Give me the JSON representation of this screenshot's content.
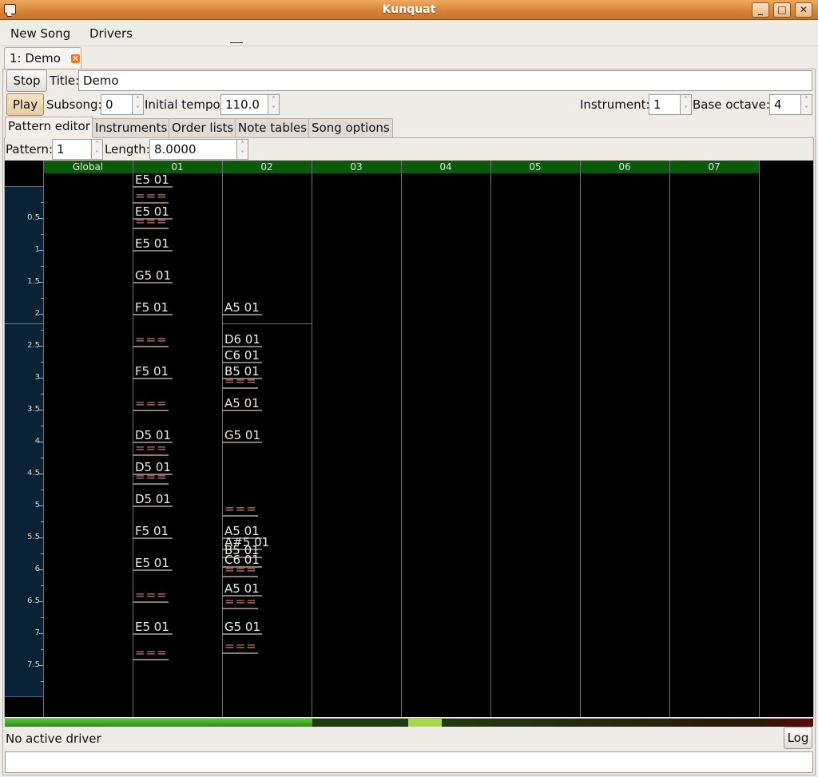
{
  "window": {
    "title": "Kunquat"
  },
  "menu": {
    "new_song": "New Song",
    "drivers": "Drivers"
  },
  "doc_tab": {
    "label": "1: Demo"
  },
  "controls": {
    "stop_label": "Stop",
    "title_label": "Title:",
    "title_value": "Demo",
    "play_label": "Play",
    "subsong_label": "Subsong:",
    "subsong_value": "0",
    "tempo_label": "Initial tempo:",
    "tempo_value": "110.0",
    "instrument_label": "Instrument:",
    "instrument_value": "1",
    "octave_label": "Base octave:",
    "octave_value": "4"
  },
  "tabs": [
    "Pattern editor",
    "Instruments",
    "Order lists",
    "Note tables",
    "Song options"
  ],
  "pattern": {
    "pattern_label": "Pattern:",
    "pattern_value": "1",
    "length_label": "Length:",
    "length_value": "8.0000",
    "columns": [
      "Global",
      "01",
      "02",
      "03",
      "04",
      "05",
      "06",
      "07"
    ],
    "ruler": [
      "0.5",
      "1",
      "1.5",
      "2",
      "2.5",
      "3",
      "3.5",
      "4",
      "4.5",
      "5",
      "5.5",
      "6",
      "6.5",
      "7",
      "7.5"
    ],
    "events": {
      "col01": [
        {
          "t": 0.0,
          "text": "E5 01"
        },
        {
          "t": 0.25,
          "text": "==="
        },
        {
          "t": 0.5,
          "text": "E5 01"
        },
        {
          "t": 0.65,
          "text": "==="
        },
        {
          "t": 1.0,
          "text": "E5 01"
        },
        {
          "t": 1.5,
          "text": "G5 01"
        },
        {
          "t": 2.0,
          "text": "F5 01"
        },
        {
          "t": 2.5,
          "text": "==="
        },
        {
          "t": 3.0,
          "text": "F5 01"
        },
        {
          "t": 3.5,
          "text": "==="
        },
        {
          "t": 4.0,
          "text": "D5 01"
        },
        {
          "t": 4.2,
          "text": "==="
        },
        {
          "t": 4.5,
          "text": "D5 01"
        },
        {
          "t": 4.65,
          "text": "==="
        },
        {
          "t": 5.0,
          "text": "D5 01"
        },
        {
          "t": 5.5,
          "text": "F5 01"
        },
        {
          "t": 6.0,
          "text": "E5 01"
        },
        {
          "t": 6.5,
          "text": "==="
        },
        {
          "t": 7.0,
          "text": "E5 01"
        },
        {
          "t": 7.4,
          "text": "==="
        }
      ],
      "col02": [
        {
          "t": 2.0,
          "text": "A5 01"
        },
        {
          "t": 2.5,
          "text": "D6 01"
        },
        {
          "t": 2.75,
          "text": "C6 01"
        },
        {
          "t": 3.0,
          "text": "B5 01"
        },
        {
          "t": 3.15,
          "text": "==="
        },
        {
          "t": 3.5,
          "text": "A5 01"
        },
        {
          "t": 4.0,
          "text": "G5 01"
        },
        {
          "t": 5.15,
          "text": "==="
        },
        {
          "t": 5.5,
          "text": "A5 01"
        },
        {
          "t": 5.67,
          "text": "A#5 01"
        },
        {
          "t": 5.8,
          "text": "B5 01"
        },
        {
          "t": 5.95,
          "text": "C6 01"
        },
        {
          "t": 6.1,
          "text": "==="
        },
        {
          "t": 6.4,
          "text": "A5 01"
        },
        {
          "t": 6.6,
          "text": "==="
        },
        {
          "t": 7.0,
          "text": "G5 01"
        },
        {
          "t": 7.3,
          "text": "==="
        }
      ]
    }
  },
  "status": {
    "text": "No active driver",
    "log_label": "Log"
  }
}
